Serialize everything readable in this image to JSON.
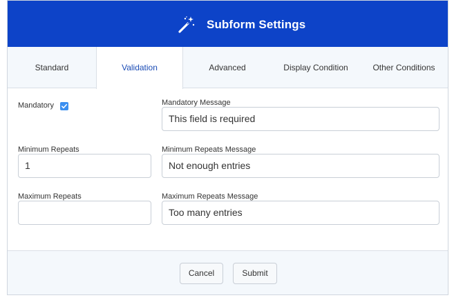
{
  "header": {
    "title": "Subform Settings",
    "icon": "magic-wand-icon"
  },
  "tabs": [
    {
      "label": "Standard"
    },
    {
      "label": "Validation",
      "active": true
    },
    {
      "label": "Advanced"
    },
    {
      "label": "Display Condition"
    },
    {
      "label": "Other Conditions"
    }
  ],
  "form": {
    "mandatory": {
      "label": "Mandatory",
      "checked": true
    },
    "mandatory_message": {
      "label": "Mandatory Message",
      "value": "This field is required"
    },
    "minimum_repeats": {
      "label": "Minimum Repeats",
      "value": "1"
    },
    "minimum_repeats_message": {
      "label": "Minimum Repeats Message",
      "value": "Not enough entries"
    },
    "maximum_repeats": {
      "label": "Maximum Repeats",
      "value": ""
    },
    "maximum_repeats_message": {
      "label": "Maximum Repeats Message",
      "value": "Too many entries"
    }
  },
  "footer": {
    "cancel_label": "Cancel",
    "submit_label": "Submit"
  },
  "colors": {
    "header_bg": "#0d43c8",
    "active_tab_text": "#1a4bb5",
    "checkbox": "#3b8ff0"
  }
}
